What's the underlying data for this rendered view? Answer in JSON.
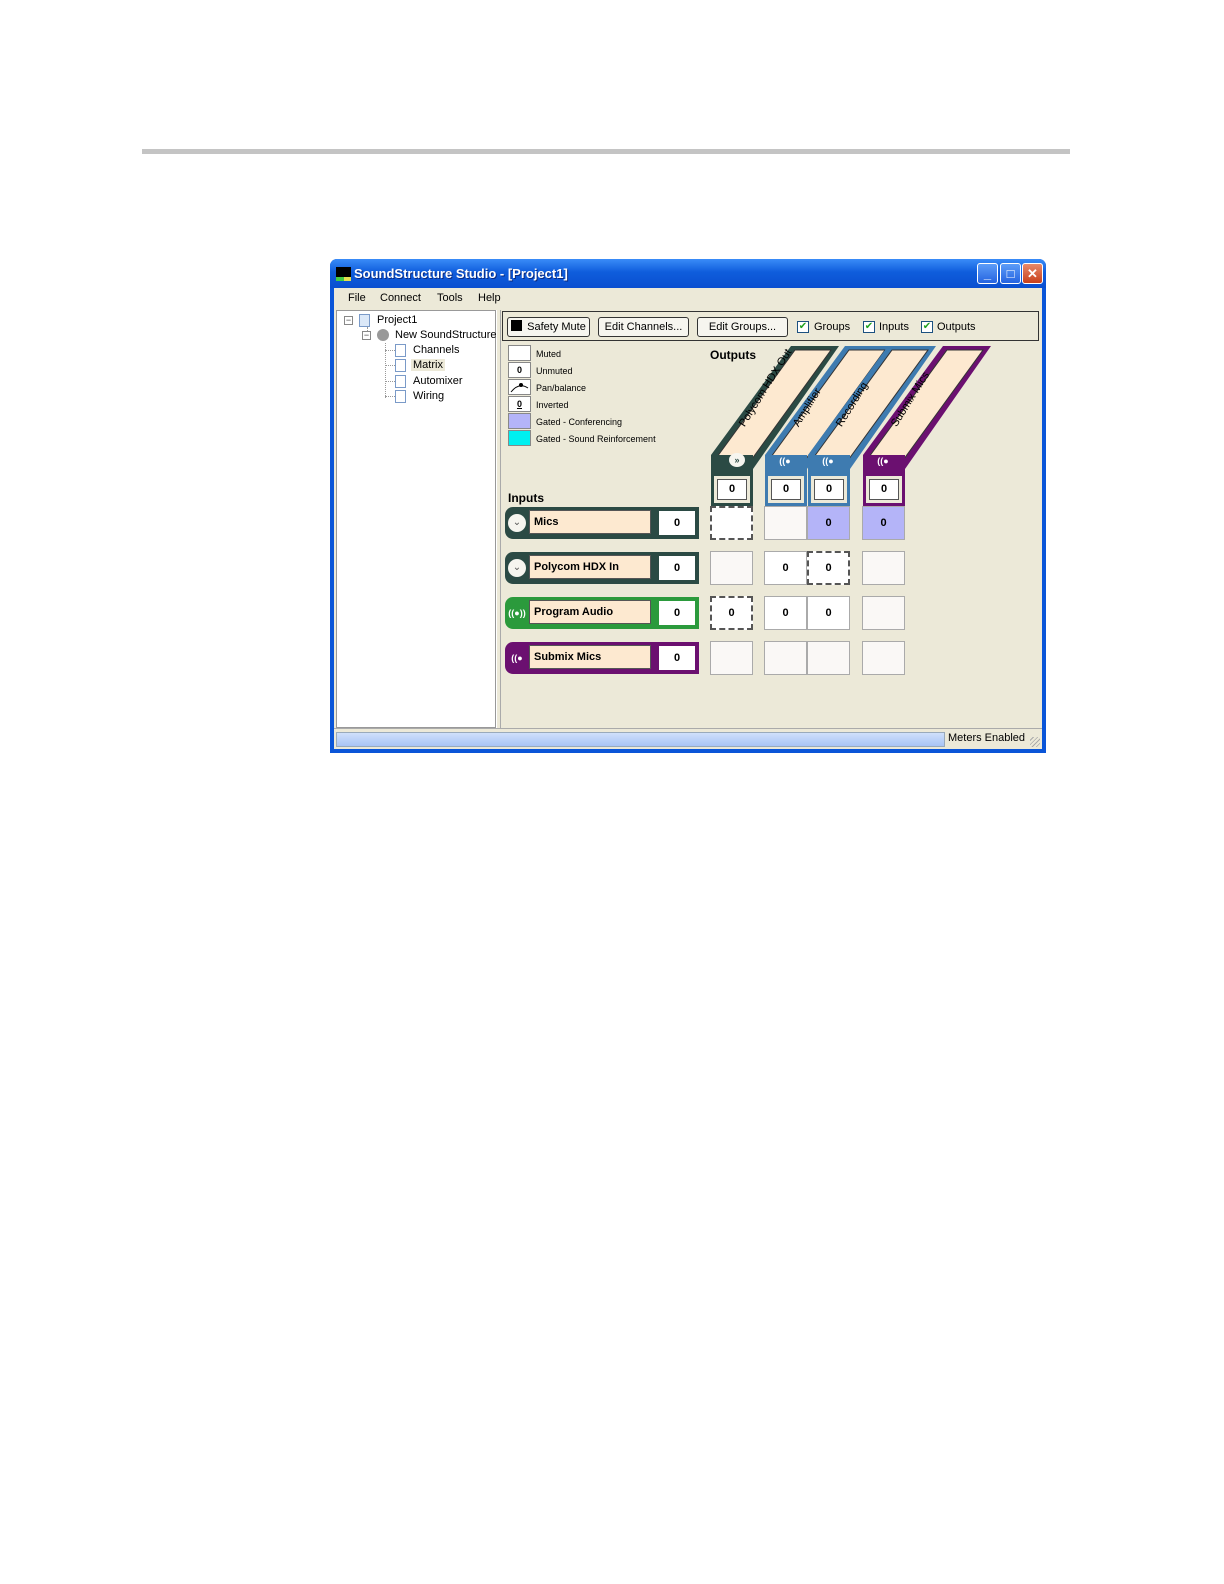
{
  "window": {
    "title": "SoundStructure Studio - [Project1]"
  },
  "menu": [
    "File",
    "Connect",
    "Tools",
    "Help"
  ],
  "tree": {
    "project": "Project1",
    "device": "New SoundStructure",
    "children": [
      "Channels",
      "Matrix",
      "Automixer",
      "Wiring"
    ],
    "selected": "Matrix"
  },
  "toolbar": {
    "safety_mute": "Safety Mute",
    "edit_channels": "Edit Channels...",
    "edit_groups": "Edit Groups...",
    "checkboxes": [
      {
        "label": "Groups",
        "checked": true
      },
      {
        "label": "Inputs",
        "checked": true
      },
      {
        "label": "Outputs",
        "checked": true
      }
    ]
  },
  "legend": [
    {
      "label": "Muted",
      "symbol": "",
      "color": "#ffffff"
    },
    {
      "label": "Unmuted",
      "symbol": "0",
      "color": "#ffffff"
    },
    {
      "label": "Pan/balance",
      "symbol": "",
      "color": "#ffffff"
    },
    {
      "label": "Inverted",
      "symbol": "0",
      "color": "#ffffff"
    },
    {
      "label": "Gated - Conferencing",
      "symbol": "",
      "color": "#b4b4f8"
    },
    {
      "label": "Gated - Sound Reinforcement",
      "symbol": "",
      "color": "#00f0f0"
    }
  ],
  "labels": {
    "outputs": "Outputs",
    "inputs": "Inputs"
  },
  "outputs": [
    {
      "name": "Polycom HDX Out",
      "gain": "0",
      "color": "#2b4a44",
      "icon": "conference-link-icon"
    },
    {
      "name": "Amplifier",
      "gain": "0",
      "color": "#3e7bb0",
      "icon": "speaker-icon"
    },
    {
      "name": "Recording",
      "gain": "0",
      "color": "#3e7bb0",
      "icon": "speaker-icon"
    },
    {
      "name": "Submix Mics",
      "gain": "0",
      "color": "#6b1070",
      "icon": "speaker-icon"
    }
  ],
  "inputs": [
    {
      "name": "Mics",
      "gain": "0",
      "color": "#2b4a44",
      "icon": "chevron-down-icon"
    },
    {
      "name": "Polycom HDX In",
      "gain": "0",
      "color": "#2b4a44",
      "icon": "chevron-down-icon"
    },
    {
      "name": "Program Audio",
      "gain": "0",
      "color": "#2b9a3c",
      "icon": "broadcast-icon"
    },
    {
      "name": "Submix Mics",
      "gain": "0",
      "color": "#6b1070",
      "icon": "speaker-icon"
    }
  ],
  "matrix": [
    [
      {
        "value": "",
        "state": "hatch"
      },
      {
        "value": "",
        "state": "muted"
      },
      {
        "value": "0",
        "state": "gated"
      },
      {
        "value": "0",
        "state": "gated"
      }
    ],
    [
      {
        "value": "",
        "state": "muted"
      },
      {
        "value": "0",
        "state": "unmuted"
      },
      {
        "value": "0",
        "state": "hatch"
      },
      {
        "value": "",
        "state": "muted"
      }
    ],
    [
      {
        "value": "0",
        "state": "hatch"
      },
      {
        "value": "0",
        "state": "unmuted"
      },
      {
        "value": "0",
        "state": "unmuted"
      },
      {
        "value": "",
        "state": "muted"
      }
    ],
    [
      {
        "value": "",
        "state": "muted"
      },
      {
        "value": "",
        "state": "muted"
      },
      {
        "value": "",
        "state": "muted"
      },
      {
        "value": "",
        "state": "muted"
      }
    ]
  ],
  "status": {
    "text": "Meters Enabled"
  }
}
